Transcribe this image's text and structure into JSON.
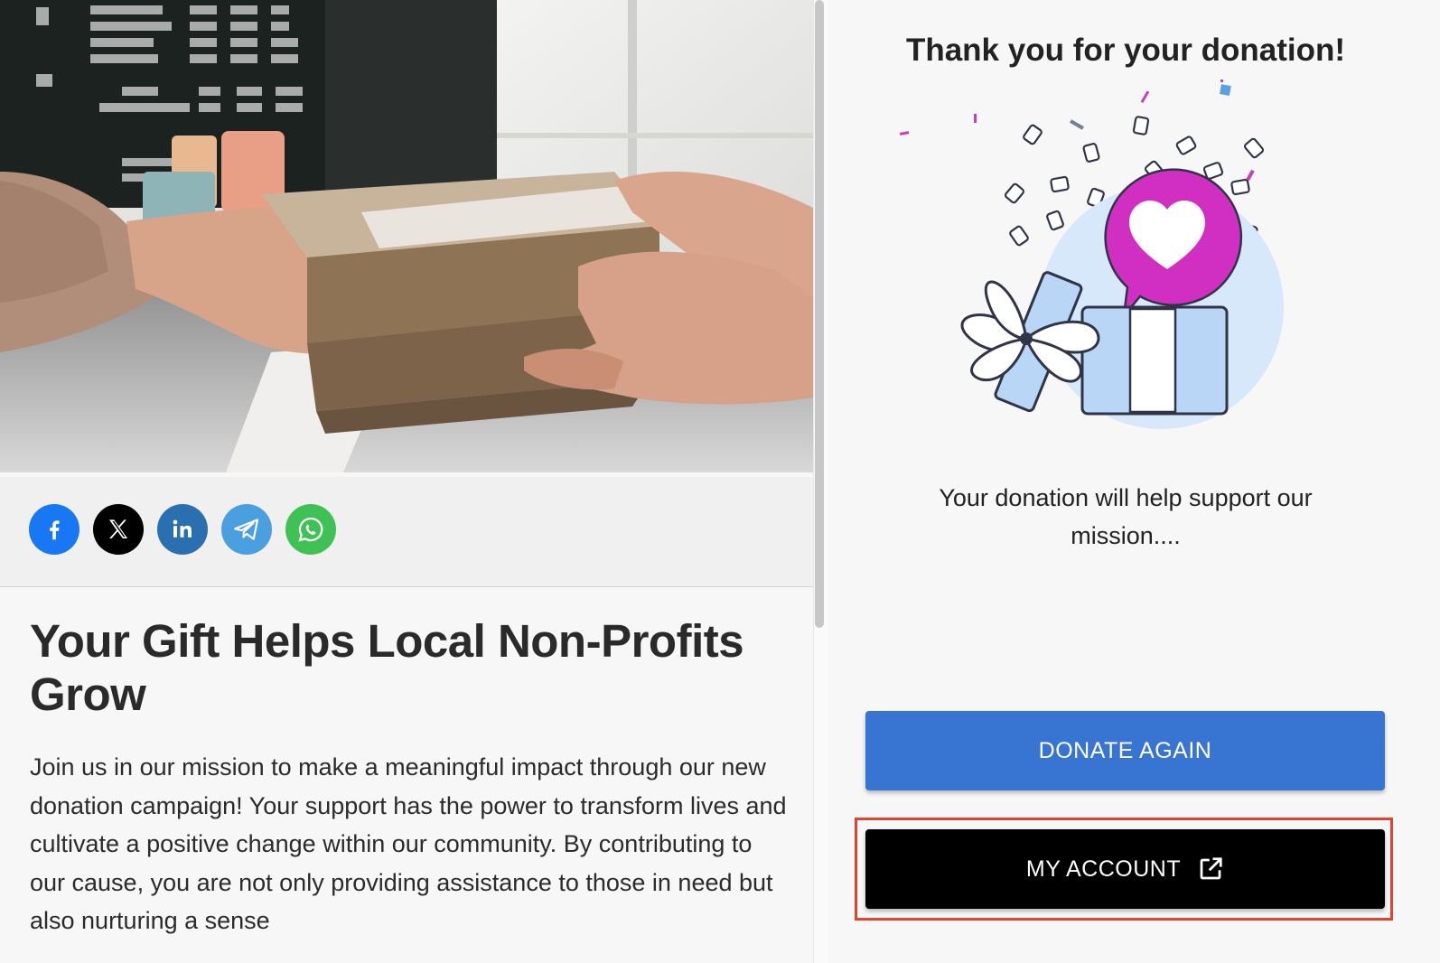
{
  "share": {
    "buttons": [
      {
        "name": "facebook",
        "icon": "facebook-icon",
        "color": "#1877f2"
      },
      {
        "name": "x",
        "icon": "x-icon",
        "color": "#000000"
      },
      {
        "name": "linkedin",
        "icon": "linkedin-icon",
        "color": "#2a6fb0"
      },
      {
        "name": "telegram",
        "icon": "telegram-icon",
        "color": "#4a9fdf"
      },
      {
        "name": "whatsapp",
        "icon": "whatsapp-icon",
        "color": "#3fc155"
      }
    ]
  },
  "article": {
    "title": "Your Gift Helps Local Non-Profits Grow",
    "body": "Join us in our mission to make a meaningful impact through our new donation campaign! Your support has the power to transform lives and cultivate a positive change within our community. By contributing to our cause, you are not only providing assistance to those in need but also nurturing a sense"
  },
  "thank_you": {
    "title": "Thank you for your donation!",
    "message": "Your donation will help support our mission....",
    "illustration_icon": "gift-heart-icon"
  },
  "buttons": {
    "donate_again": "DONATE AGAIN",
    "my_account": "MY ACCOUNT",
    "my_account_icon": "external-link-icon"
  },
  "colors": {
    "primary": "#3874d1",
    "account_button": "#000000",
    "heart_bubble": "#d02fc1",
    "gift_blue": "#b9d6f7",
    "highlight": "#e0442b"
  }
}
